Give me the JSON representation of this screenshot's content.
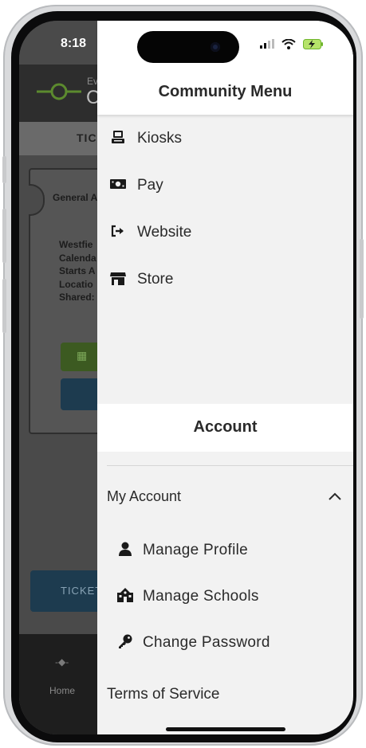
{
  "status": {
    "time": "8:18",
    "signal": "signal-icon",
    "wifi": "wifi-icon",
    "battery": "battery-charging-icon"
  },
  "background_app": {
    "title_small": "Ev",
    "title_big": "C",
    "tab": "TIC",
    "card_label": "General A",
    "card_lines": [
      "Westfie",
      "Calenda",
      "Starts A",
      "Locatio",
      "Shared:"
    ],
    "tickets_button": "TICKET",
    "nav_home": "Home"
  },
  "drawer": {
    "title": "Community Menu",
    "menu": [
      {
        "label": "Kiosks",
        "icon": "kiosk-icon"
      },
      {
        "label": "Pay",
        "icon": "money-icon"
      },
      {
        "label": "Website",
        "icon": "external-link-icon"
      },
      {
        "label": "Store",
        "icon": "store-icon"
      }
    ],
    "account_title": "Account",
    "my_account": {
      "label": "My Account",
      "expanded": true
    },
    "account_items": [
      {
        "label": "Manage Profile",
        "icon": "user-icon"
      },
      {
        "label": "Manage Schools",
        "icon": "school-icon"
      },
      {
        "label": "Change Password",
        "icon": "key-icon"
      }
    ],
    "terms": "Terms of Service"
  },
  "colors": {
    "accent_green": "#3c5a21",
    "accent_blue": "#1d3b4f",
    "drawer_bg": "#f2f2f2"
  }
}
